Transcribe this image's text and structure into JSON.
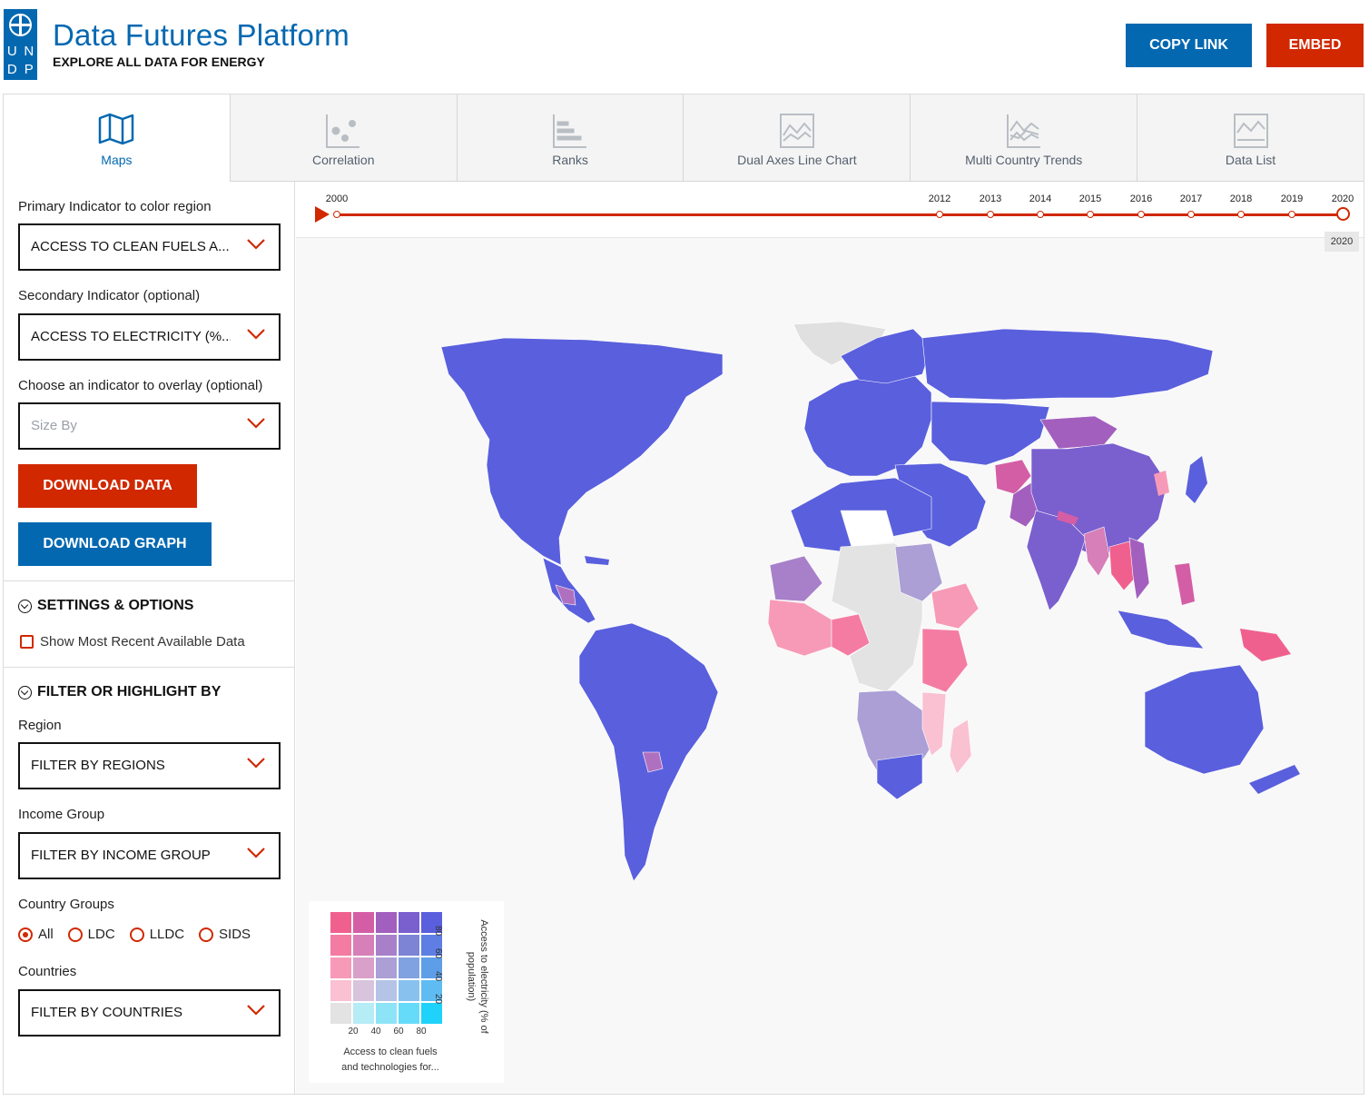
{
  "header": {
    "title": "Data Futures Platform",
    "subtitle": "EXPLORE ALL DATA FOR ENERGY",
    "logo_letters": [
      "U",
      "N",
      "D",
      "P"
    ],
    "copy_link_label": "COPY LINK",
    "embed_label": "EMBED"
  },
  "tabs": [
    {
      "label": "Maps",
      "icon": "map-icon",
      "active": true
    },
    {
      "label": "Correlation",
      "icon": "scatter-icon"
    },
    {
      "label": "Ranks",
      "icon": "bar-ranks-icon"
    },
    {
      "label": "Dual Axes Line Chart",
      "icon": "line-chart-icon"
    },
    {
      "label": "Multi Country Trends",
      "icon": "multi-line-icon"
    },
    {
      "label": "Data List",
      "icon": "list-chart-icon"
    }
  ],
  "sidebar": {
    "primary_label": "Primary Indicator to color region",
    "primary_value": "ACCESS TO CLEAN FUELS A...",
    "secondary_label": "Secondary Indicator (optional)",
    "secondary_value": "ACCESS TO ELECTRICITY (%...",
    "overlay_label": "Choose an indicator to overlay (optional)",
    "overlay_placeholder": "Size By",
    "download_data": "DOWNLOAD DATA",
    "download_graph": "DOWNLOAD GRAPH",
    "settings_heading": "SETTINGS & OPTIONS",
    "most_recent_label": "Show Most Recent Available Data",
    "filter_heading": "FILTER OR HIGHLIGHT BY",
    "region_label": "Region",
    "region_value": "FILTER BY REGIONS",
    "income_label": "Income Group",
    "income_value": "FILTER BY INCOME GROUP",
    "country_groups_label": "Country Groups",
    "country_groups": [
      {
        "label": "All",
        "selected": true
      },
      {
        "label": "LDC",
        "selected": false
      },
      {
        "label": "LLDC",
        "selected": false
      },
      {
        "label": "SIDS",
        "selected": false
      }
    ],
    "countries_label": "Countries",
    "countries_value": "FILTER BY COUNTRIES"
  },
  "timeline": {
    "years": [
      "2000",
      "2012",
      "2013",
      "2014",
      "2015",
      "2016",
      "2017",
      "2018",
      "2019",
      "2020"
    ],
    "selected_year": "2020"
  },
  "legend": {
    "x_ticks": [
      "20",
      "40",
      "60",
      "80"
    ],
    "y_ticks": [
      "20",
      "40",
      "60",
      "80"
    ],
    "x_label_line1": "Access to clean fuels",
    "x_label_line2": "and technologies for...",
    "y_label": "Access to electricity (% of population)",
    "grid_colors": [
      [
        "#f0608e",
        "#d45ea6",
        "#a35fbd",
        "#7a5fcf",
        "#5a5fdd"
      ],
      [
        "#f47ca3",
        "#d67fb8",
        "#a780c9",
        "#7d84d6",
        "#5e7ee3"
      ],
      [
        "#f79ab8",
        "#d9a0c9",
        "#ab9fd5",
        "#80a2e0",
        "#5e9ee8"
      ],
      [
        "#f9c1d2",
        "#d9c4dd",
        "#b4c3e6",
        "#88c1ee",
        "#5fbcf3"
      ],
      [
        "#e3e3e3",
        "#b6ecf6",
        "#8ee4f7",
        "#66dbf9",
        "#1fd2fb"
      ]
    ]
  },
  "colors": {
    "brand_blue": "#0468b1",
    "accent_red": "#d12800",
    "map_high": "#5a5fdd"
  }
}
